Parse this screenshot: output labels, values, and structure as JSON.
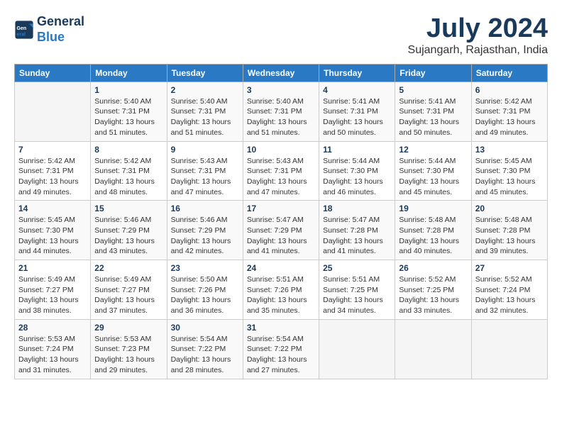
{
  "header": {
    "logo_general": "General",
    "logo_blue": "Blue",
    "month_year": "July 2024",
    "location": "Sujangarh, Rajasthan, India"
  },
  "days_of_week": [
    "Sunday",
    "Monday",
    "Tuesday",
    "Wednesday",
    "Thursday",
    "Friday",
    "Saturday"
  ],
  "weeks": [
    [
      {
        "day": "",
        "info": ""
      },
      {
        "day": "1",
        "info": "Sunrise: 5:40 AM\nSunset: 7:31 PM\nDaylight: 13 hours\nand 51 minutes."
      },
      {
        "day": "2",
        "info": "Sunrise: 5:40 AM\nSunset: 7:31 PM\nDaylight: 13 hours\nand 51 minutes."
      },
      {
        "day": "3",
        "info": "Sunrise: 5:40 AM\nSunset: 7:31 PM\nDaylight: 13 hours\nand 51 minutes."
      },
      {
        "day": "4",
        "info": "Sunrise: 5:41 AM\nSunset: 7:31 PM\nDaylight: 13 hours\nand 50 minutes."
      },
      {
        "day": "5",
        "info": "Sunrise: 5:41 AM\nSunset: 7:31 PM\nDaylight: 13 hours\nand 50 minutes."
      },
      {
        "day": "6",
        "info": "Sunrise: 5:42 AM\nSunset: 7:31 PM\nDaylight: 13 hours\nand 49 minutes."
      }
    ],
    [
      {
        "day": "7",
        "info": "Sunrise: 5:42 AM\nSunset: 7:31 PM\nDaylight: 13 hours\nand 49 minutes."
      },
      {
        "day": "8",
        "info": "Sunrise: 5:42 AM\nSunset: 7:31 PM\nDaylight: 13 hours\nand 48 minutes."
      },
      {
        "day": "9",
        "info": "Sunrise: 5:43 AM\nSunset: 7:31 PM\nDaylight: 13 hours\nand 47 minutes."
      },
      {
        "day": "10",
        "info": "Sunrise: 5:43 AM\nSunset: 7:31 PM\nDaylight: 13 hours\nand 47 minutes."
      },
      {
        "day": "11",
        "info": "Sunrise: 5:44 AM\nSunset: 7:30 PM\nDaylight: 13 hours\nand 46 minutes."
      },
      {
        "day": "12",
        "info": "Sunrise: 5:44 AM\nSunset: 7:30 PM\nDaylight: 13 hours\nand 45 minutes."
      },
      {
        "day": "13",
        "info": "Sunrise: 5:45 AM\nSunset: 7:30 PM\nDaylight: 13 hours\nand 45 minutes."
      }
    ],
    [
      {
        "day": "14",
        "info": "Sunrise: 5:45 AM\nSunset: 7:30 PM\nDaylight: 13 hours\nand 44 minutes."
      },
      {
        "day": "15",
        "info": "Sunrise: 5:46 AM\nSunset: 7:29 PM\nDaylight: 13 hours\nand 43 minutes."
      },
      {
        "day": "16",
        "info": "Sunrise: 5:46 AM\nSunset: 7:29 PM\nDaylight: 13 hours\nand 42 minutes."
      },
      {
        "day": "17",
        "info": "Sunrise: 5:47 AM\nSunset: 7:29 PM\nDaylight: 13 hours\nand 41 minutes."
      },
      {
        "day": "18",
        "info": "Sunrise: 5:47 AM\nSunset: 7:28 PM\nDaylight: 13 hours\nand 41 minutes."
      },
      {
        "day": "19",
        "info": "Sunrise: 5:48 AM\nSunset: 7:28 PM\nDaylight: 13 hours\nand 40 minutes."
      },
      {
        "day": "20",
        "info": "Sunrise: 5:48 AM\nSunset: 7:28 PM\nDaylight: 13 hours\nand 39 minutes."
      }
    ],
    [
      {
        "day": "21",
        "info": "Sunrise: 5:49 AM\nSunset: 7:27 PM\nDaylight: 13 hours\nand 38 minutes."
      },
      {
        "day": "22",
        "info": "Sunrise: 5:49 AM\nSunset: 7:27 PM\nDaylight: 13 hours\nand 37 minutes."
      },
      {
        "day": "23",
        "info": "Sunrise: 5:50 AM\nSunset: 7:26 PM\nDaylight: 13 hours\nand 36 minutes."
      },
      {
        "day": "24",
        "info": "Sunrise: 5:51 AM\nSunset: 7:26 PM\nDaylight: 13 hours\nand 35 minutes."
      },
      {
        "day": "25",
        "info": "Sunrise: 5:51 AM\nSunset: 7:25 PM\nDaylight: 13 hours\nand 34 minutes."
      },
      {
        "day": "26",
        "info": "Sunrise: 5:52 AM\nSunset: 7:25 PM\nDaylight: 13 hours\nand 33 minutes."
      },
      {
        "day": "27",
        "info": "Sunrise: 5:52 AM\nSunset: 7:24 PM\nDaylight: 13 hours\nand 32 minutes."
      }
    ],
    [
      {
        "day": "28",
        "info": "Sunrise: 5:53 AM\nSunset: 7:24 PM\nDaylight: 13 hours\nand 31 minutes."
      },
      {
        "day": "29",
        "info": "Sunrise: 5:53 AM\nSunset: 7:23 PM\nDaylight: 13 hours\nand 29 minutes."
      },
      {
        "day": "30",
        "info": "Sunrise: 5:54 AM\nSunset: 7:22 PM\nDaylight: 13 hours\nand 28 minutes."
      },
      {
        "day": "31",
        "info": "Sunrise: 5:54 AM\nSunset: 7:22 PM\nDaylight: 13 hours\nand 27 minutes."
      },
      {
        "day": "",
        "info": ""
      },
      {
        "day": "",
        "info": ""
      },
      {
        "day": "",
        "info": ""
      }
    ]
  ]
}
